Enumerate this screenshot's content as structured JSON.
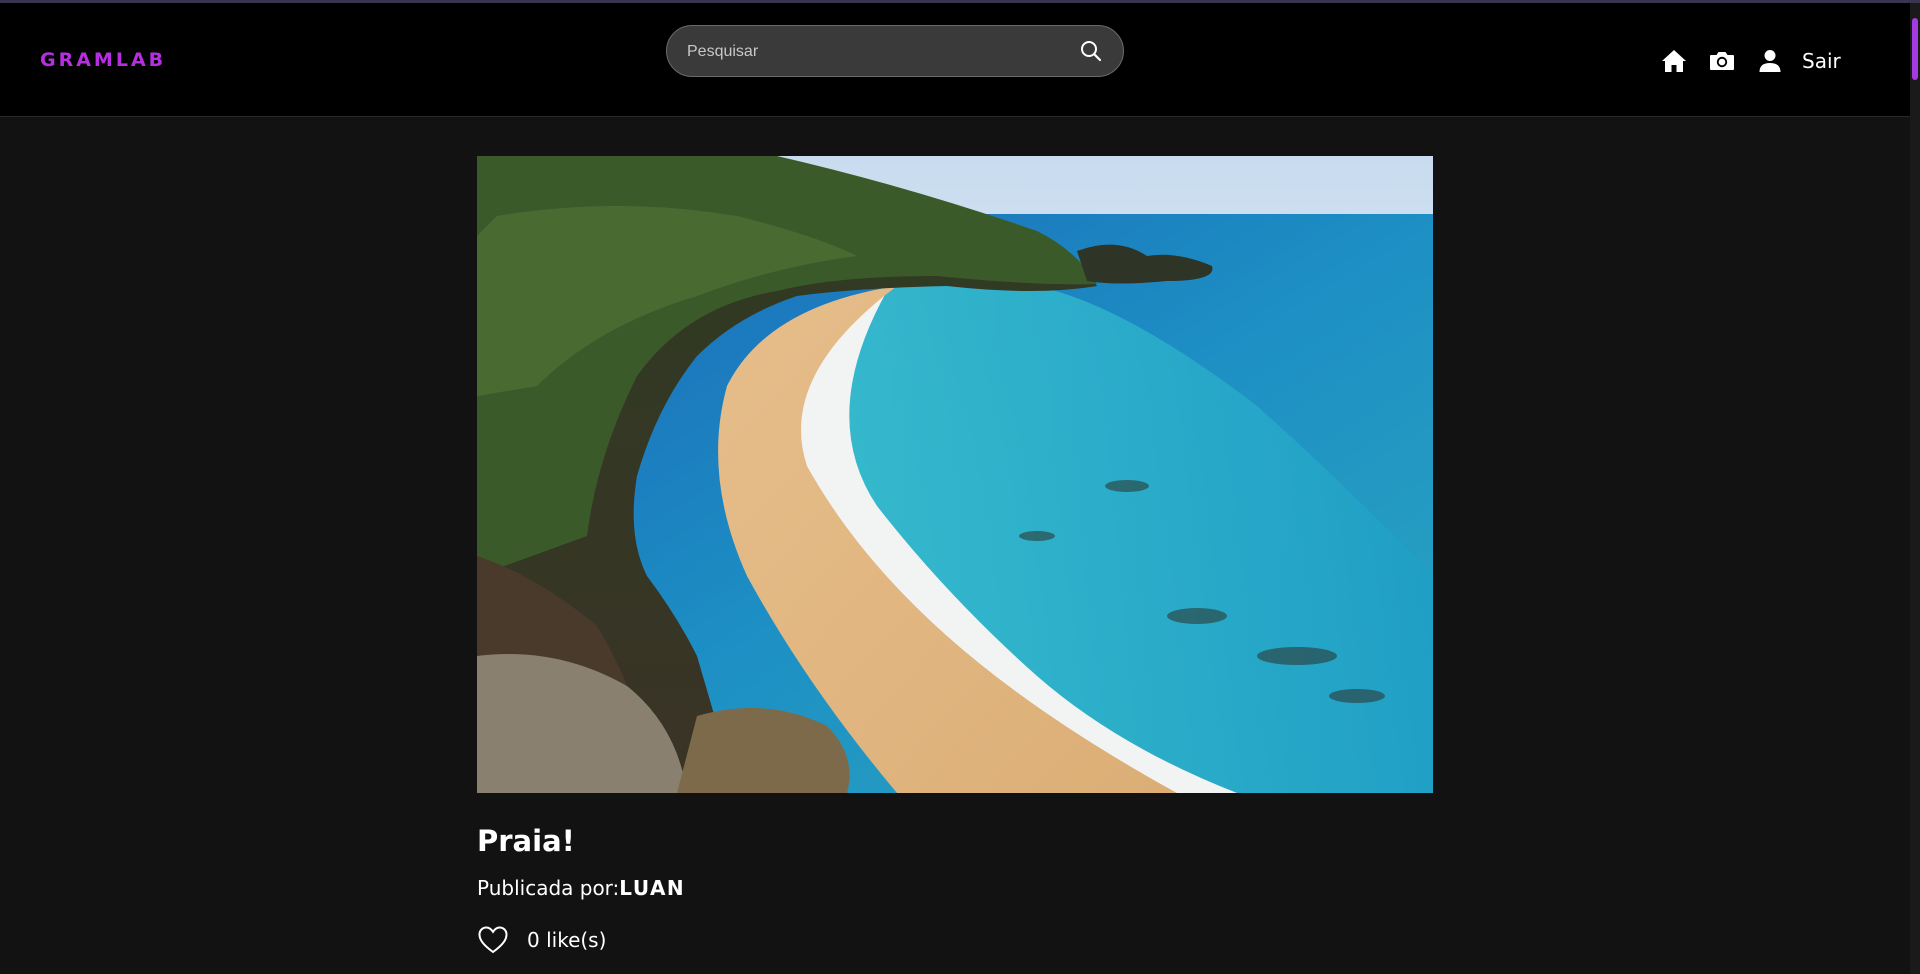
{
  "app": {
    "logo": "GRAMLAB",
    "accent_color": "#b52fe0"
  },
  "header": {
    "search_placeholder": "Pesquisar",
    "search_value": "",
    "nav_icons": [
      "home-icon",
      "camera-icon",
      "user-icon"
    ],
    "logout_label": "Sair"
  },
  "post": {
    "image_subject": "beach",
    "title": "Praia!",
    "published_by_label": "Publicada por:",
    "author": "LUAN",
    "likes_label": "0 like(s)"
  }
}
